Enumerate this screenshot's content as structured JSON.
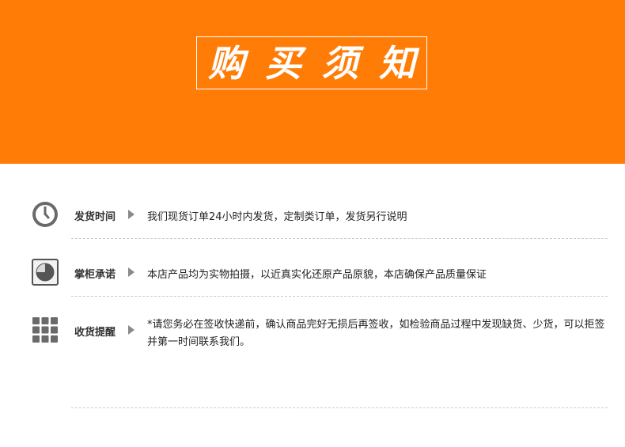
{
  "header": {
    "title": "购买须知",
    "background_color": "#ff7d07"
  },
  "items": [
    {
      "icon": "clock-icon",
      "label": "发货时间",
      "text": "我们现货订单24小时内发货，定制类订单，发货另行说明"
    },
    {
      "icon": "pie-chart-icon",
      "label": "掌柜承诺",
      "text": "本店产品均为实物拍摄，以近真实化还原产品原貌，本店确保产品质量保证"
    },
    {
      "icon": "grid-icon",
      "label": "收货提醒",
      "text": "*请您务必在签收快递前，确认商品完好无损后再签收，如检验商品过程中发现缺货、少货，可以拒签并第一时间联系我们。"
    }
  ]
}
